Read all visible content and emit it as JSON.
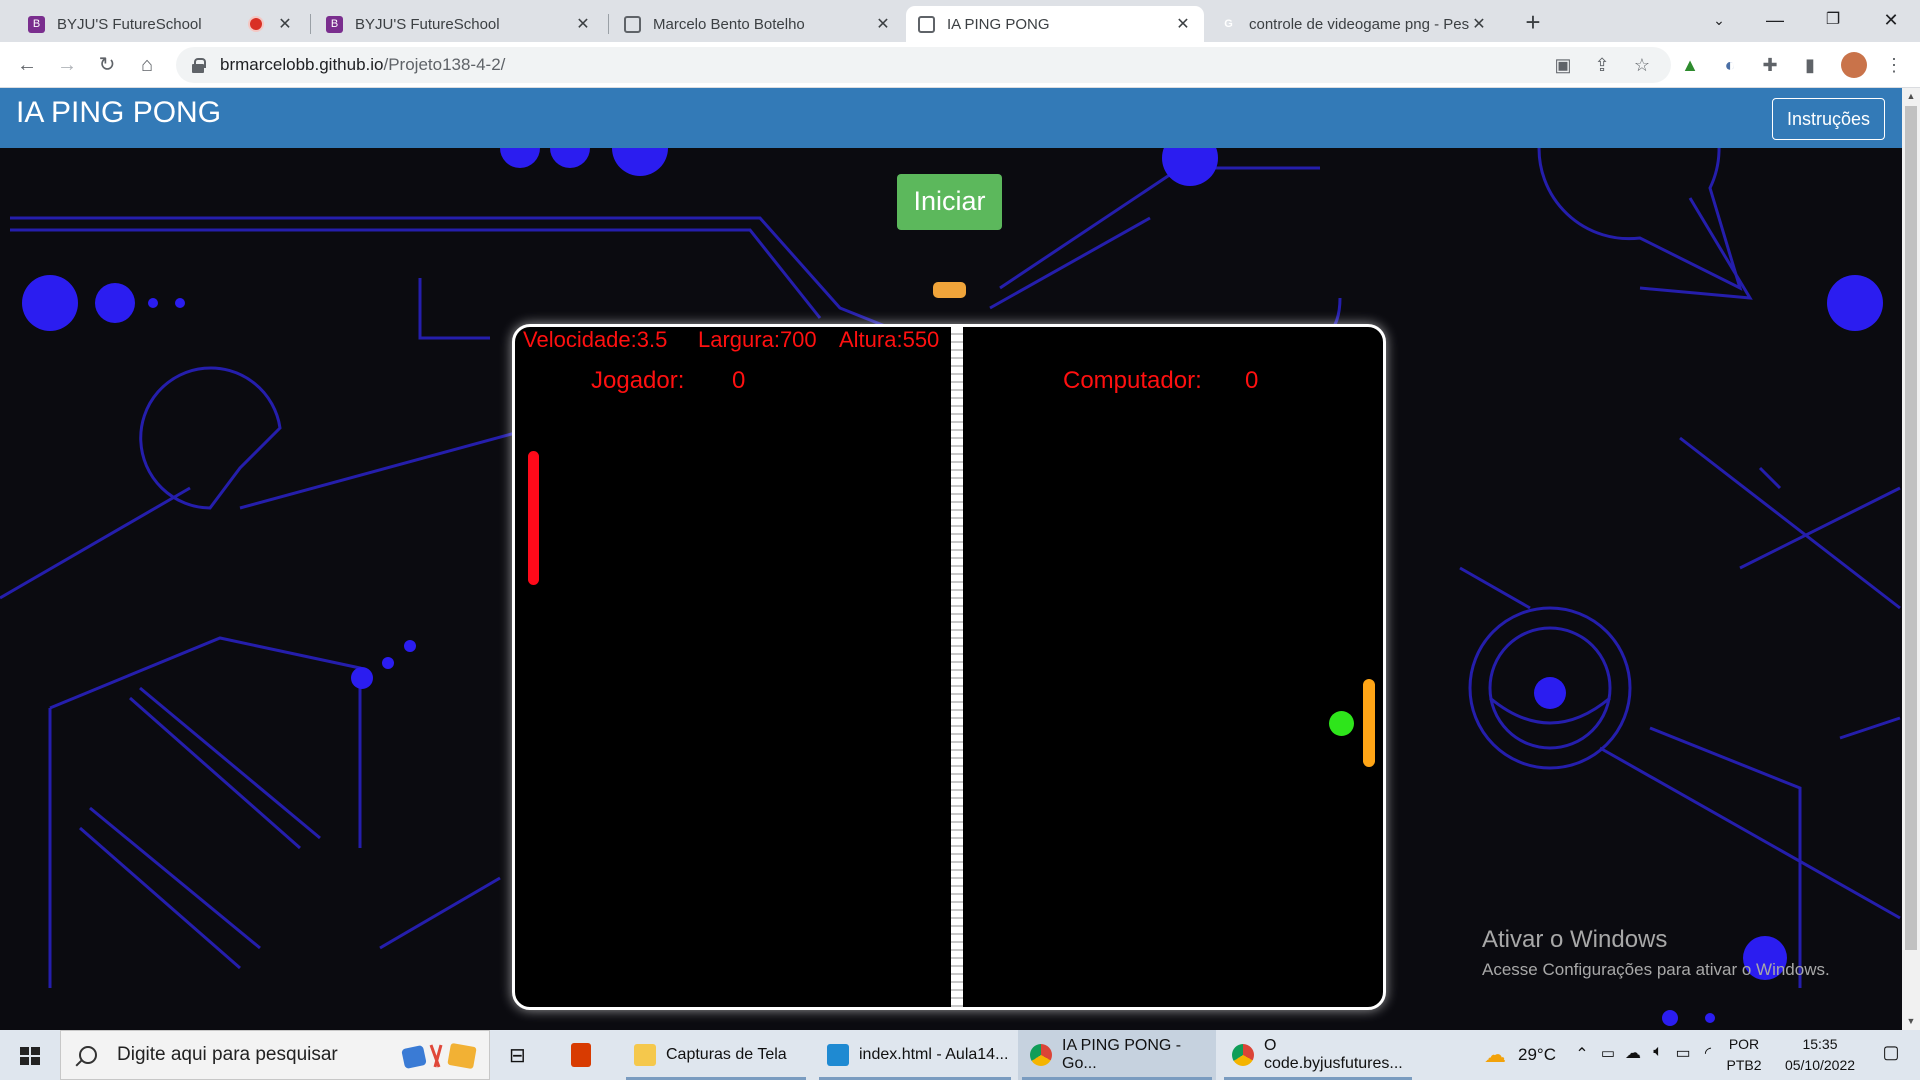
{
  "browser": {
    "tabs": [
      {
        "title": "BYJU'S FutureSchool",
        "favicon": "byjus-icon",
        "recording": true,
        "active": false
      },
      {
        "title": "BYJU'S FutureSchool",
        "favicon": "byjus-icon",
        "recording": false,
        "active": false
      },
      {
        "title": "Marcelo Bento Botelho",
        "favicon": "globe-icon",
        "recording": false,
        "active": false
      },
      {
        "title": "IA PING PONG",
        "favicon": "globe-icon",
        "recording": false,
        "active": true
      },
      {
        "title": "controle de videogame png - Pes",
        "favicon": "google-icon",
        "recording": false,
        "active": false
      }
    ],
    "url_host": "brmarcelobb.github.io",
    "url_path": "/Projeto138-4-2/"
  },
  "page": {
    "brand": "IA PING PONG",
    "instructions_label": "Instruções",
    "start_label": "Iniciar",
    "game": {
      "speed_text": "Velocidade:3.5",
      "width_text": "Largura:700",
      "height_text": "Altura:550",
      "player_label": "Jogador:",
      "player_score": "0",
      "computer_label": "Computador:",
      "computer_score": "0",
      "colors": {
        "player_paddle": "#ff0a1a",
        "computer_paddle": "#ffa516",
        "ball": "#2ee51b",
        "hud_text": "#ff1010"
      }
    },
    "activation": {
      "title": "Ativar o Windows",
      "subtitle": "Acesse Configurações para ativar o Windows."
    }
  },
  "taskbar": {
    "search_placeholder": "Digite aqui para pesquisar",
    "apps": [
      {
        "label": "Capturas de Tela",
        "icon": "folder-icon"
      },
      {
        "label": "index.html - Aula14...",
        "icon": "vscode-icon"
      },
      {
        "label": "IA PING PONG - Go...",
        "icon": "chrome-icon"
      },
      {
        "label": "O code.byjusfutures...",
        "icon": "chrome-icon"
      }
    ],
    "weather": "29°C",
    "language": "POR",
    "layout": "PTB2",
    "time": "15:35",
    "date": "05/10/2022"
  }
}
